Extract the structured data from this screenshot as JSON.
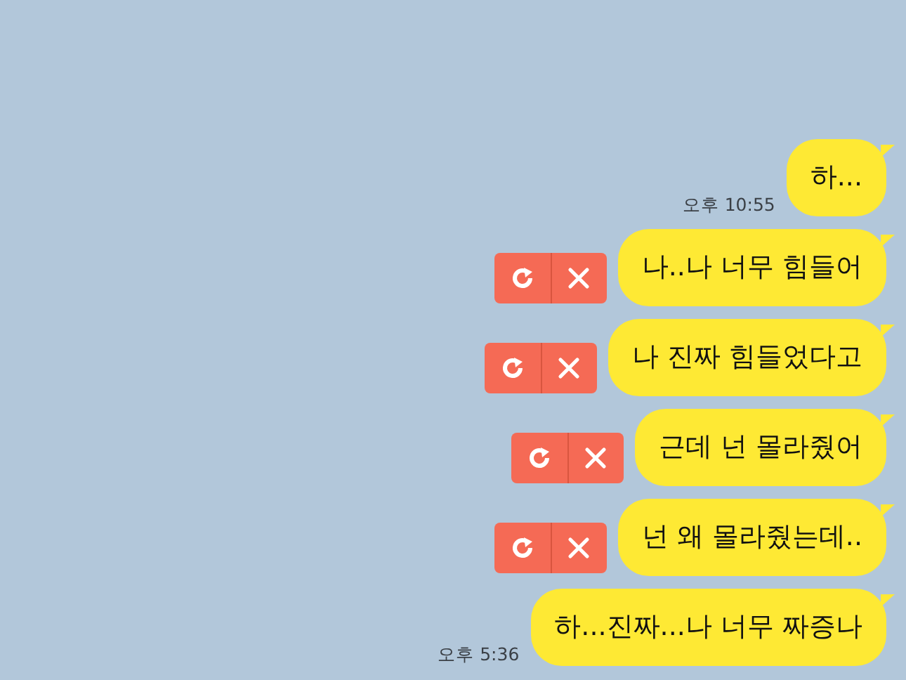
{
  "messages": [
    {
      "text": "하...",
      "time": "오후 10:55",
      "failed": false
    },
    {
      "text": "나..나 너무 힘들어",
      "failed": true
    },
    {
      "text": "나 진짜 힘들었다고",
      "failed": true
    },
    {
      "text": "근데 넌 몰라줬어",
      "failed": true
    },
    {
      "text": "넌 왜 몰라줬는데..",
      "failed": true
    },
    {
      "text": "하...진짜...나 너무 짜증나",
      "time": "오후 5:36",
      "failed": false
    }
  ]
}
